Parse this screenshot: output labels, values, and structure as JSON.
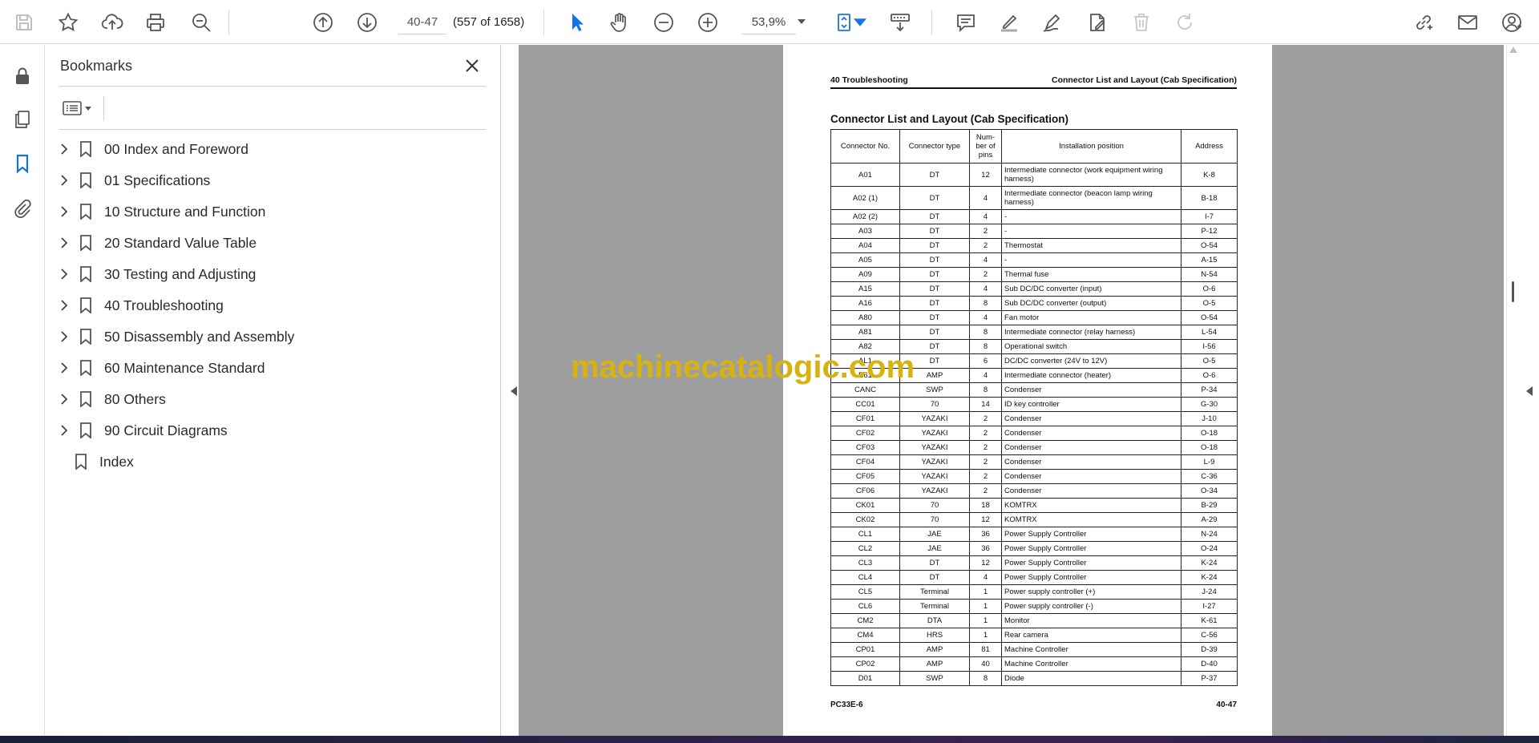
{
  "toolbar": {
    "page_value": "40-47",
    "page_count": "(557 of 1658)",
    "zoom_value": "53,9%",
    "icons": [
      "save-icon",
      "star-icon",
      "upload-cloud-icon",
      "print-icon",
      "zoom-search-icon",
      "page-up-icon",
      "page-down-icon",
      "select-cursor-icon",
      "hand-tool-icon",
      "zoom-out-icon",
      "zoom-in-icon",
      "zoom-dropdown-icon",
      "fit-page-icon",
      "scroll-mode-icon",
      "comment-icon",
      "highlight-icon",
      "draw-icon",
      "fill-sign-icon",
      "delete-icon",
      "redo-icon",
      "link-icon",
      "email-icon",
      "user-icon"
    ],
    "accent_color": "#1473e6"
  },
  "rail": {
    "icons": [
      "lock-icon",
      "pages-icon",
      "bookmark-icon",
      "attachment-icon"
    ]
  },
  "bookmarks": {
    "title": "Bookmarks",
    "items": [
      {
        "label": "00 Index and Foreword",
        "expandable": true
      },
      {
        "label": "01 Specifications",
        "expandable": true
      },
      {
        "label": "10 Structure and Function",
        "expandable": true
      },
      {
        "label": "20 Standard Value Table",
        "expandable": true
      },
      {
        "label": "30 Testing and Adjusting",
        "expandable": true
      },
      {
        "label": "40 Troubleshooting",
        "expandable": true
      },
      {
        "label": "50 Disassembly and Assembly",
        "expandable": true
      },
      {
        "label": "60 Maintenance Standard",
        "expandable": true
      },
      {
        "label": "80 Others",
        "expandable": true
      },
      {
        "label": "90 Circuit Diagrams",
        "expandable": true
      },
      {
        "label": "Index",
        "expandable": false
      }
    ]
  },
  "doc": {
    "header_left": "40 Troubleshooting",
    "header_right": "Connector List and Layout (Cab Specification)",
    "title": "Connector List and Layout (Cab Specification)",
    "columns": [
      "Connector No.",
      "Connector type",
      "Num-\nber of\npins",
      "Installation position",
      "Address"
    ],
    "rows": [
      [
        "A01",
        "DT",
        "12",
        "Intermediate connector (work equipment wiring harness)",
        "K-8"
      ],
      [
        "A02 (1)",
        "DT",
        "4",
        "Intermediate connector (beacon lamp wiring harness)",
        "B-18"
      ],
      [
        "A02 (2)",
        "DT",
        "4",
        "-",
        "I-7"
      ],
      [
        "A03",
        "DT",
        "2",
        "-",
        "P-12"
      ],
      [
        "A04",
        "DT",
        "2",
        "Thermostat",
        "O-54"
      ],
      [
        "A05",
        "DT",
        "4",
        "-",
        "A-15"
      ],
      [
        "A09",
        "DT",
        "2",
        "Thermal fuse",
        "N-54"
      ],
      [
        "A15",
        "DT",
        "4",
        "Sub DC/DC converter (input)",
        "O-6"
      ],
      [
        "A16",
        "DT",
        "8",
        "Sub DC/DC converter (output)",
        "O-5"
      ],
      [
        "A80",
        "DT",
        "4",
        "Fan motor",
        "O-54"
      ],
      [
        "A81",
        "DT",
        "8",
        "Intermediate connector (relay harness)",
        "L-54"
      ],
      [
        "A82",
        "DT",
        "8",
        "Operational switch",
        "I-56"
      ],
      [
        "AL1",
        "DT",
        "6",
        "DC/DC converter (24V to 12V)",
        "O-5"
      ],
      [
        "B61",
        "AMP",
        "4",
        "Intermediate connector (heater)",
        "O-6"
      ],
      [
        "CANC",
        "SWP",
        "8",
        "Condenser",
        "P-34"
      ],
      [
        "CC01",
        "70",
        "14",
        "ID key controller",
        "G-30"
      ],
      [
        "CF01",
        "YAZAKI",
        "2",
        "Condenser",
        "J-10"
      ],
      [
        "CF02",
        "YAZAKI",
        "2",
        "Condenser",
        "O-18"
      ],
      [
        "CF03",
        "YAZAKI",
        "2",
        "Condenser",
        "O-18"
      ],
      [
        "CF04",
        "YAZAKI",
        "2",
        "Condenser",
        "L-9"
      ],
      [
        "CF05",
        "YAZAKI",
        "2",
        "Condenser",
        "C-36"
      ],
      [
        "CF06",
        "YAZAKI",
        "2",
        "Condenser",
        "O-34"
      ],
      [
        "CK01",
        "70",
        "18",
        "KOMTRX",
        "B-29"
      ],
      [
        "CK02",
        "70",
        "12",
        "KOMTRX",
        "A-29"
      ],
      [
        "CL1",
        "JAE",
        "36",
        "Power Supply Controller",
        "N-24"
      ],
      [
        "CL2",
        "JAE",
        "36",
        "Power Supply Controller",
        "O-24"
      ],
      [
        "CL3",
        "DT",
        "12",
        "Power Supply Controller",
        "K-24"
      ],
      [
        "CL4",
        "DT",
        "4",
        "Power Supply Controller",
        "K-24"
      ],
      [
        "CL5",
        "Terminal",
        "1",
        "Power supply controller (+)",
        "J-24"
      ],
      [
        "CL6",
        "Terminal",
        "1",
        "Power supply controller (-)",
        "I-27"
      ],
      [
        "CM2",
        "DTA",
        "1",
        "Monitor",
        "K-61"
      ],
      [
        "CM4",
        "HRS",
        "1",
        "Rear camera",
        "C-56"
      ],
      [
        "CP01",
        "AMP",
        "81",
        "Machine Controller",
        "D-39"
      ],
      [
        "CP02",
        "AMP",
        "40",
        "Machine Controller",
        "D-40"
      ],
      [
        "D01",
        "SWP",
        "8",
        "Diode",
        "P-37"
      ]
    ],
    "footer_left": "PC33E-6",
    "footer_right": "40-47"
  },
  "watermark": "machinecatalogic.com"
}
